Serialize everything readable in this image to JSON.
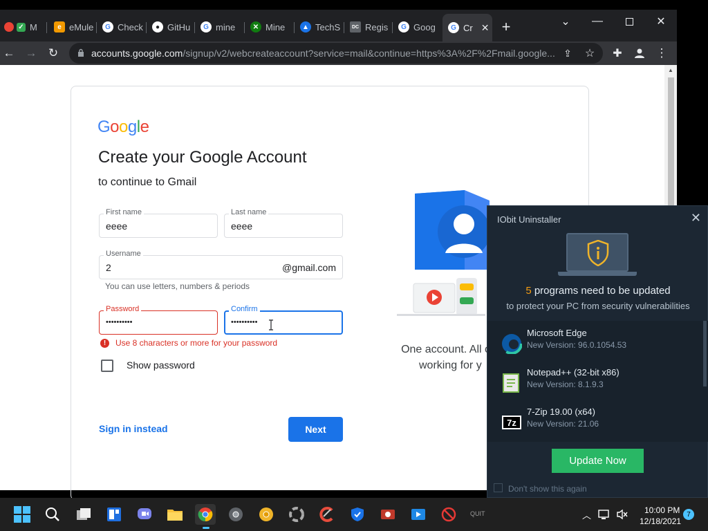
{
  "browser": {
    "tabs": [
      {
        "label": "M",
        "favicon": "gmail-icon",
        "color": "#ea4335"
      },
      {
        "label": "eMule",
        "favicon": "emule-icon",
        "color": "#f29900"
      },
      {
        "label": "Check",
        "favicon": "google-icon",
        "color": "#4285f4"
      },
      {
        "label": "GitHu",
        "favicon": "github-icon",
        "color": "#ffffff"
      },
      {
        "label": "mine",
        "favicon": "google-icon",
        "color": "#4285f4"
      },
      {
        "label": "Mine",
        "favicon": "xbox-icon",
        "color": "#107c10"
      },
      {
        "label": "TechS",
        "favicon": "techsmith-icon",
        "color": "#1a73e8"
      },
      {
        "label": "Regis",
        "favicon": "dmc-icon",
        "color": "#888888"
      },
      {
        "label": "Goog",
        "favicon": "google-icon",
        "color": "#4285f4"
      },
      {
        "label": "Cr",
        "favicon": "google-icon",
        "color": "#4285f4"
      }
    ],
    "new_tab": "+",
    "url_host": "accounts.google.com",
    "url_rest": "/signup/v2/webcreateaccount?service=mail&continue=https%3A%2F%2Fmail.google..."
  },
  "page": {
    "logo": [
      "G",
      "o",
      "o",
      "g",
      "l",
      "e"
    ],
    "logo_colors": [
      "#4285f4",
      "#ea4335",
      "#fbbc05",
      "#4285f4",
      "#34a853",
      "#ea4335"
    ],
    "heading": "Create your Google Account",
    "subheading": "to continue to Gmail",
    "first_name_label": "First name",
    "first_name_value": "eeee",
    "last_name_label": "Last name",
    "last_name_value": "eeee",
    "username_label": "Username",
    "username_value": "2",
    "username_suffix": "@gmail.com",
    "username_hint": "You can use letters, numbers & periods",
    "password_label": "Password",
    "password_value": "••••••••••",
    "confirm_label": "Confirm",
    "confirm_value": "••••••••••",
    "password_error": "Use 8 characters or more for your password",
    "show_password": "Show password",
    "sign_in": "Sign in instead",
    "next": "Next",
    "tagline_1": "One account. All o",
    "tagline_2": "working for y"
  },
  "iobit": {
    "title": "IObit Uninstaller",
    "count": "5",
    "count_text": " programs need to be updated",
    "subtitle": "to protect your PC from security vulnerabilities",
    "items": [
      {
        "name": "Microsoft Edge",
        "version": "New Version: 96.0.1054.53",
        "icon": "edge-icon"
      },
      {
        "name": "Notepad++ (32-bit x86)",
        "version": "New Version: 8.1.9.3",
        "icon": "notepadpp-icon"
      },
      {
        "name": "7-Zip 19.00 (x64)",
        "version": "New Version: 21.06",
        "icon": "7zip-icon"
      }
    ],
    "update_button": "Update Now",
    "dont_show": "Don't show this again"
  },
  "taskbar": {
    "quit_label": "QUIT",
    "time": "10:00 PM",
    "date": "12/18/2021",
    "notifications": "7"
  }
}
